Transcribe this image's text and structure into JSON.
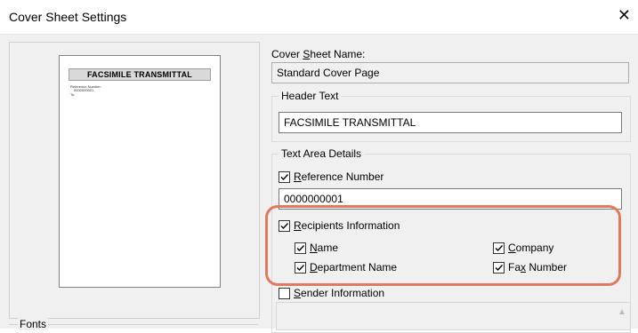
{
  "window": {
    "title": "Cover Sheet Settings",
    "close_glyph": "✕"
  },
  "preview": {
    "header_text": "FACSIMILE TRANSMITTAL",
    "ref_label": "Reference Number:",
    "ref_value": "0000000001",
    "to_label": "To:"
  },
  "fonts": {
    "legend": "Fonts"
  },
  "cover_sheet_name": {
    "label_prefix": "Cover ",
    "label_access": "S",
    "label_rest": "heet Name:",
    "value": "Standard Cover Page"
  },
  "header_text_group": {
    "legend": "Header Text",
    "value": "FACSIMILE TRANSMITTAL"
  },
  "text_area_details": {
    "legend": "Text Area Details",
    "reference_number": {
      "checked": true,
      "label_access": "R",
      "label_rest": "eference Number",
      "value": "0000000001"
    },
    "recipients_information": {
      "checked": true,
      "label_access": "R",
      "label_rest": "ecipients Information",
      "items": {
        "name": {
          "checked": true,
          "label_access": "N",
          "label_rest": "ame"
        },
        "company": {
          "checked": true,
          "label_access": "C",
          "label_rest": "ompany"
        },
        "department_name": {
          "checked": true,
          "label_access": "D",
          "label_rest": "epartment Name"
        },
        "fax_number": {
          "checked": true,
          "label_prefix": "Fa",
          "label_access": "x",
          "label_rest": " Number"
        }
      }
    },
    "sender_information": {
      "checked": false,
      "label_access": "S",
      "label_rest": "ender Information"
    }
  },
  "colors": {
    "highlight": "#e07a5f",
    "dialog_bg": "#f0f0f0"
  }
}
